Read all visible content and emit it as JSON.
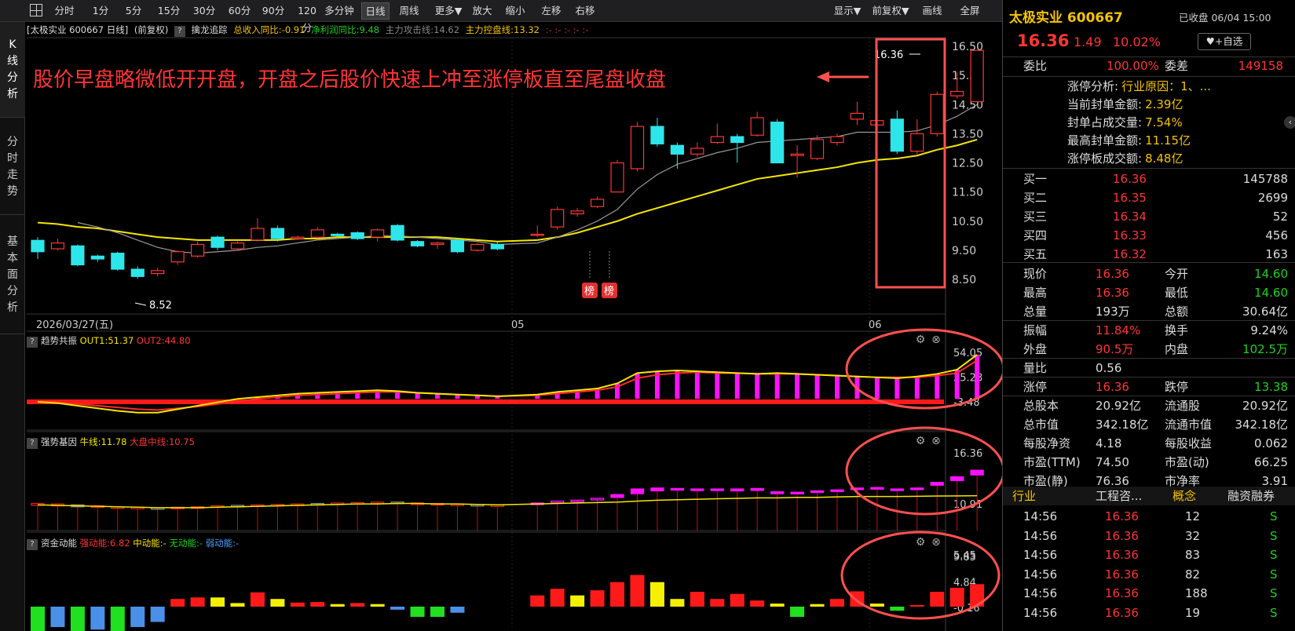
{
  "toolbar": {
    "items": [
      "分时",
      "1分",
      "5分",
      "15分",
      "30分",
      "60分",
      "90分",
      "120分",
      "多分钟",
      "日线",
      "周线",
      "更多▼",
      "放大",
      "缩小",
      "左移",
      "右移"
    ],
    "right_items": [
      "显示▼",
      "前复权▼",
      "画线",
      "全屏"
    ]
  },
  "side_tabs": [
    "K\n线\n分\n析",
    "分\n时\n走\n势",
    "基\n本\n面\n分\n析"
  ],
  "info": {
    "stock": "[太极实业 600667 日线]",
    "adjust": "(前复权)",
    "indicator": "擒龙追踪",
    "rev": "总收入同比:-0.91",
    "profit": "净利润同比:9.48",
    "attack": "主力攻击线:14.62",
    "control": "主力控盘线:13.32",
    "dots": ":- :- :- :- :-"
  },
  "annotation": "股价早盘略微低开开盘，开盘之后股价快速上冲至涨停板直至尾盘收盘",
  "main_chart": {
    "type": "candlestick",
    "price_axis": [
      "16.50",
      "15.50",
      "14.50",
      "13.50",
      "12.50",
      "11.50",
      "10.50",
      "9.50",
      "8.50"
    ],
    "date_labels": [
      "2026/03/27(五)",
      "05",
      "06"
    ],
    "high_label": "16.36",
    "low_label": "8.52",
    "badge": "榜",
    "candles": [
      [
        9.84,
        9.45,
        9.95,
        9.2
      ],
      [
        9.55,
        9.75,
        9.9,
        9.5
      ],
      [
        9.65,
        9.0,
        9.7,
        8.95
      ],
      [
        9.3,
        9.2,
        9.35,
        9.1
      ],
      [
        9.4,
        8.85,
        9.45,
        8.8
      ],
      [
        8.85,
        8.6,
        8.95,
        8.52
      ],
      [
        8.7,
        8.8,
        8.9,
        8.6
      ],
      [
        9.1,
        9.45,
        9.5,
        9.0
      ],
      [
        9.3,
        9.7,
        9.8,
        9.25
      ],
      [
        9.95,
        9.6,
        10.0,
        9.5
      ],
      [
        9.55,
        9.75,
        9.8,
        9.5
      ],
      [
        9.85,
        10.25,
        10.6,
        9.8
      ],
      [
        10.25,
        9.9,
        10.35,
        9.8
      ],
      [
        9.9,
        9.95,
        10.0,
        9.85
      ],
      [
        9.95,
        10.2,
        10.3,
        9.9
      ],
      [
        10.05,
        10.0,
        10.1,
        9.95
      ],
      [
        10.1,
        9.9,
        10.15,
        9.85
      ],
      [
        9.95,
        10.2,
        10.25,
        9.8
      ],
      [
        10.35,
        9.85,
        10.4,
        9.8
      ],
      [
        9.8,
        9.65,
        9.85,
        9.6
      ],
      [
        9.7,
        9.75,
        9.8,
        9.55
      ],
      [
        9.85,
        9.45,
        9.9,
        9.4
      ],
      [
        9.5,
        9.7,
        9.75,
        9.45
      ],
      [
        9.7,
        9.55,
        9.8,
        9.5
      ],
      [
        null,
        null,
        null,
        null
      ],
      [
        10.05,
        10.05,
        10.35,
        9.95
      ],
      [
        10.3,
        10.9,
        11.0,
        10.2
      ],
      [
        10.75,
        10.85,
        10.95,
        10.65
      ],
      [
        11.0,
        11.25,
        11.35,
        10.95
      ],
      [
        11.5,
        12.5,
        12.6,
        11.5
      ],
      [
        12.3,
        13.75,
        13.9,
        12.2
      ],
      [
        13.75,
        13.15,
        14.05,
        13.05
      ],
      [
        13.1,
        12.8,
        13.2,
        12.3
      ],
      [
        12.8,
        13.0,
        13.2,
        12.7
      ],
      [
        13.2,
        13.4,
        13.85,
        13.15
      ],
      [
        13.4,
        13.2,
        13.5,
        12.5
      ],
      [
        13.45,
        14.05,
        14.25,
        13.4
      ],
      [
        13.9,
        12.5,
        14.0,
        12.5
      ],
      [
        12.75,
        12.8,
        13.1,
        12.0
      ],
      [
        12.65,
        13.3,
        13.45,
        12.6
      ],
      [
        13.2,
        13.4,
        13.5,
        13.1
      ],
      [
        14.0,
        14.2,
        14.6,
        13.8
      ],
      [
        13.8,
        13.95,
        14.1,
        13.45
      ],
      [
        14.0,
        12.9,
        14.3,
        12.8
      ],
      [
        12.9,
        13.5,
        14.0,
        12.8
      ],
      [
        13.5,
        14.85,
        14.95,
        13.4
      ],
      [
        14.8,
        14.95,
        15.6,
        14.7
      ],
      [
        14.6,
        16.36,
        16.36,
        14.6
      ]
    ],
    "ma_short": [
      null,
      null,
      10.45,
      10.3,
      10.1,
      9.85,
      9.6,
      9.45,
      9.4,
      9.45,
      9.5,
      9.6,
      9.65,
      9.75,
      9.85,
      9.9,
      9.95,
      10.0,
      10.0,
      9.95,
      9.9,
      9.85,
      9.8,
      9.7,
      null,
      9.75,
      9.95,
      10.2,
      10.5,
      10.9,
      11.6,
      12.1,
      12.45,
      12.65,
      12.85,
      13.0,
      13.2,
      13.25,
      13.3,
      13.35,
      13.4,
      13.55,
      13.55,
      13.55,
      13.6,
      13.8,
      14.1,
      14.5
    ],
    "ma_long": [
      10.45,
      10.4,
      10.3,
      10.25,
      10.15,
      10.05,
      9.95,
      9.9,
      9.85,
      9.85,
      9.85,
      9.85,
      9.85,
      9.9,
      9.9,
      9.95,
      9.95,
      9.95,
      9.95,
      9.95,
      9.95,
      9.9,
      9.85,
      9.8,
      null,
      9.85,
      9.95,
      10.1,
      10.3,
      10.5,
      10.75,
      10.95,
      11.15,
      11.35,
      11.55,
      11.75,
      11.95,
      12.05,
      12.15,
      12.25,
      12.35,
      12.5,
      12.6,
      12.65,
      12.75,
      12.95,
      13.1,
      13.3
    ]
  },
  "trend_panel": {
    "title": "趋势共振",
    "out1": "OUT1:51.37",
    "out2": "OUT2:44.80",
    "axis": [
      "54.05",
      "25.28",
      "-3.48"
    ],
    "out1_values": [
      -3.5,
      -5,
      -8,
      -11,
      -14,
      -16,
      -16,
      -12,
      -8,
      -4,
      0,
      2,
      4,
      6,
      7,
      8,
      9,
      10,
      9,
      7,
      6,
      5,
      4,
      3,
      null,
      5,
      8,
      10,
      12,
      18,
      30,
      32,
      33,
      32,
      31,
      30,
      29,
      30,
      29,
      28,
      27,
      26,
      25,
      24,
      26,
      29,
      34,
      51.4
    ],
    "out2_values": [
      -3,
      -4,
      -6,
      -8,
      -10,
      -12,
      -13,
      -11,
      -9,
      -6,
      -3,
      0,
      2,
      4,
      5,
      6,
      7,
      8,
      8,
      7,
      6,
      5,
      4,
      3,
      null,
      4,
      6,
      8,
      10,
      14,
      24,
      28,
      30,
      31,
      30,
      30,
      29,
      29,
      29,
      28,
      27,
      26,
      25,
      25,
      25,
      27,
      30,
      44.8
    ]
  },
  "gene_panel": {
    "title": "强势基因",
    "bull": "牛线:11.78",
    "market": "大盘中线:10.75",
    "axis": [
      "16.36",
      "10.91",
      "5.45"
    ],
    "boxes": [
      [
        10.95,
        10.75
      ],
      [
        10.9,
        10.7
      ],
      [
        10.8,
        10.6
      ],
      [
        10.7,
        10.55
      ],
      [
        10.6,
        10.5
      ],
      [
        10.55,
        10.4
      ],
      [
        10.5,
        10.4
      ],
      [
        10.55,
        10.5
      ],
      [
        10.6,
        10.55
      ],
      [
        10.7,
        10.6
      ],
      [
        10.75,
        10.7
      ],
      [
        10.8,
        10.75
      ],
      [
        10.85,
        10.8
      ],
      [
        10.9,
        10.85
      ],
      [
        10.95,
        10.9
      ],
      [
        11.0,
        10.95
      ],
      [
        11.05,
        11.0
      ],
      [
        11.1,
        11.05
      ],
      [
        11.1,
        11.05
      ],
      [
        11.0,
        10.95
      ],
      [
        10.95,
        10.9
      ],
      [
        10.9,
        10.85
      ],
      [
        10.85,
        10.8
      ],
      [
        10.8,
        10.75
      ],
      [
        null,
        null
      ],
      [
        11.0,
        10.95
      ],
      [
        11.2,
        11.1
      ],
      [
        11.3,
        11.25
      ],
      [
        11.5,
        11.4
      ],
      [
        11.9,
        11.6
      ],
      [
        12.5,
        12.0
      ],
      [
        12.6,
        12.3
      ],
      [
        12.55,
        12.4
      ],
      [
        12.5,
        12.4
      ],
      [
        12.5,
        12.4
      ],
      [
        12.5,
        12.3
      ],
      [
        12.55,
        12.35
      ],
      [
        12.2,
        12.0
      ],
      [
        12.15,
        12.0
      ],
      [
        12.3,
        12.15
      ],
      [
        12.4,
        12.3
      ],
      [
        12.6,
        12.5
      ],
      [
        12.65,
        12.55
      ],
      [
        12.5,
        12.35
      ],
      [
        12.6,
        12.5
      ],
      [
        13.2,
        12.9
      ],
      [
        13.8,
        13.4
      ],
      [
        14.5,
        14.0
      ]
    ],
    "bull_line": [
      10.8,
      10.75,
      10.7,
      10.65,
      10.6,
      10.55,
      10.5,
      10.5,
      10.5,
      10.55,
      10.6,
      10.65,
      10.7,
      10.75,
      10.8,
      10.85,
      10.9,
      10.9,
      10.95,
      10.95,
      10.9,
      10.9,
      10.85,
      10.8,
      null,
      10.9,
      10.95,
      11.0,
      11.05,
      11.1,
      11.2,
      11.3,
      11.35,
      11.4,
      11.45,
      11.5,
      11.55,
      11.55,
      11.6,
      11.6,
      11.65,
      11.7,
      11.7,
      11.7,
      11.72,
      11.75,
      11.76,
      11.78
    ]
  },
  "fund_panel": {
    "title": "资金动能",
    "strong": "强动能:6.82",
    "mid": "中动能:-",
    "none": "无动能:-",
    "weak": "弱动能:-",
    "axis": [
      "9.83",
      "4.84",
      "-0.16"
    ],
    "bars": [
      [
        -6,
        "green"
      ],
      [
        -4,
        "blue"
      ],
      [
        -6,
        "green"
      ],
      [
        -4.5,
        "blue"
      ],
      [
        -5,
        "green"
      ],
      [
        -4,
        "blue"
      ],
      [
        -3,
        "blue"
      ],
      [
        1.5,
        "red"
      ],
      [
        1.8,
        "red"
      ],
      [
        1.8,
        "yellow"
      ],
      [
        0.7,
        "yellow"
      ],
      [
        2.8,
        "red"
      ],
      [
        1.5,
        "yellow"
      ],
      [
        0.8,
        "red"
      ],
      [
        0.9,
        "red"
      ],
      [
        0.5,
        "yellow"
      ],
      [
        0.7,
        "red"
      ],
      [
        0.5,
        "yellow"
      ],
      [
        -0.6,
        "blue"
      ],
      [
        -2,
        "green"
      ],
      [
        -2,
        "green"
      ],
      [
        -1.2,
        "blue"
      ],
      [
        null,
        null
      ],
      [
        null,
        null
      ],
      [
        null,
        null
      ],
      [
        2.2,
        "red"
      ],
      [
        3.5,
        "red"
      ],
      [
        2.2,
        "yellow"
      ],
      [
        3.2,
        "red"
      ],
      [
        4.8,
        "red"
      ],
      [
        6.2,
        "red"
      ],
      [
        4.8,
        "yellow"
      ],
      [
        1.5,
        "yellow"
      ],
      [
        2.9,
        "red"
      ],
      [
        1.5,
        "red"
      ],
      [
        2.5,
        "red"
      ],
      [
        1.2,
        "red"
      ],
      [
        0.6,
        "yellow"
      ],
      [
        -2,
        "green"
      ],
      [
        0.5,
        "yellow"
      ],
      [
        1.5,
        "red"
      ],
      [
        3,
        "red"
      ],
      [
        0.6,
        "yellow"
      ],
      [
        -0.8,
        "green"
      ],
      [
        0.3,
        "red"
      ],
      [
        2.9,
        "red"
      ],
      [
        3.7,
        "red"
      ],
      [
        4.4,
        "red"
      ]
    ]
  },
  "quote": {
    "name": "太极实业 600667",
    "status": "已收盘 06/04 15:00",
    "price": "16.36",
    "change": "1.49",
    "pct": "10.02%",
    "fav": "♥+自选",
    "weibi_l": "委比",
    "weibi_v": "100.00%",
    "weicha_l": "委差",
    "weicha_v": "149158",
    "limit_lines": [
      [
        "涨停分析:",
        "行业原因：1、..."
      ],
      [
        "当前封单金额:",
        "2.39亿"
      ],
      [
        "封单占成交量:",
        "7.54%"
      ],
      [
        "最高封单金额:",
        "11.15亿"
      ],
      [
        "涨停板成交额:",
        "8.48亿"
      ]
    ],
    "bids": [
      [
        "买一",
        "16.36",
        "145788"
      ],
      [
        "买二",
        "16.35",
        "2699"
      ],
      [
        "买三",
        "16.34",
        "52"
      ],
      [
        "买四",
        "16.33",
        "456"
      ],
      [
        "买五",
        "16.32",
        "163"
      ]
    ],
    "stats": [
      [
        "现价",
        "16.36",
        "red",
        "今开",
        "14.60",
        "green"
      ],
      [
        "最高",
        "16.36",
        "red",
        "最低",
        "14.60",
        "green"
      ],
      [
        "总量",
        "193万",
        "white",
        "总额",
        "30.64亿",
        "white"
      ],
      [
        "振幅",
        "11.84%",
        "red",
        "换手",
        "9.24%",
        "white"
      ],
      [
        "外盘",
        "90.5万",
        "red",
        "内盘",
        "102.5万",
        "green"
      ],
      [
        "量比",
        "0.56",
        "white",
        "",
        null,
        null
      ],
      [
        "涨停",
        "16.36",
        "red",
        "跌停",
        "13.38",
        "green"
      ],
      [
        "总股本",
        "20.92亿",
        "white",
        "流通股",
        "20.92亿",
        "white"
      ],
      [
        "总市值",
        "342.18亿",
        "white",
        "流通市值",
        "342.18亿",
        "white"
      ],
      [
        "每股净资",
        "4.18",
        "white",
        "每股收益",
        "0.062",
        "white"
      ],
      [
        "市盈(TTM)",
        "74.50",
        "white",
        "市盈(动)",
        "66.25",
        "white"
      ],
      [
        "市盈(静)",
        "76.36",
        "white",
        "市净率",
        "3.91",
        "white"
      ]
    ],
    "tags": [
      "行业",
      "工程咨...",
      "概念",
      "融资融券"
    ],
    "ticks": [
      [
        "14:56",
        "16.36",
        "12",
        "S"
      ],
      [
        "14:56",
        "16.36",
        "32",
        "S"
      ],
      [
        "14:56",
        "16.36",
        "83",
        "S"
      ],
      [
        "14:56",
        "16.36",
        "82",
        "S"
      ],
      [
        "14:56",
        "16.36",
        "188",
        "S"
      ],
      [
        "14:56",
        "16.36",
        "19",
        "S"
      ]
    ]
  },
  "colors": {
    "up": "#ff3535",
    "down": "#2ce6ea",
    "ma_short": "#e03030",
    "ma_long": "#f5e600",
    "magenta": "#ff10ff",
    "circle": "#ff5050"
  }
}
